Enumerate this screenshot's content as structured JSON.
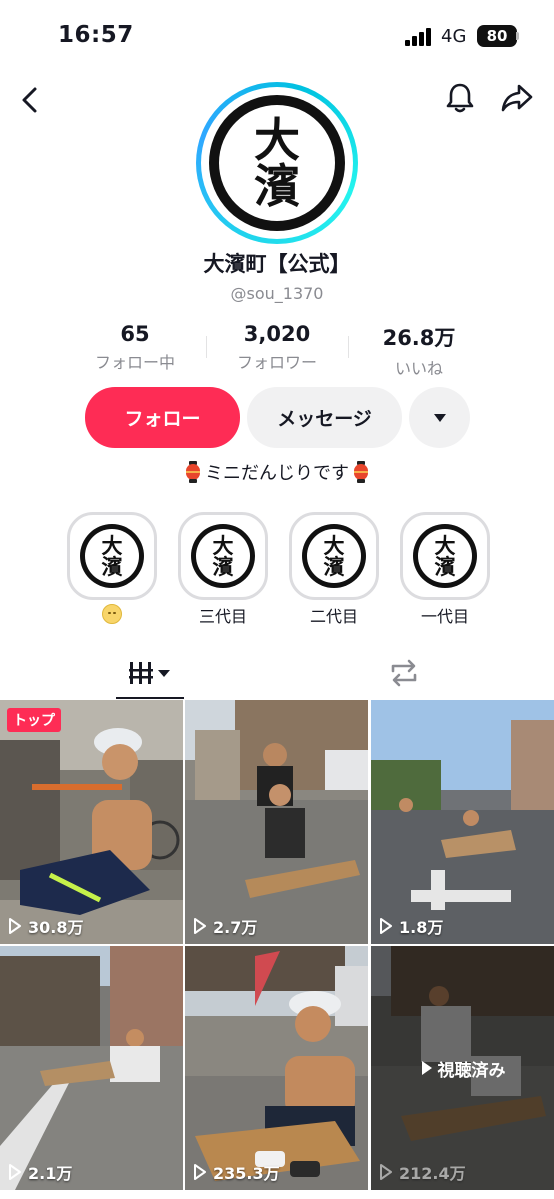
{
  "status": {
    "time": "16:57",
    "network": "4G",
    "battery": "80"
  },
  "header": {
    "back_icon": "chevron-left-icon",
    "bell_icon": "bell-icon",
    "share_icon": "share-arrow-icon"
  },
  "profile": {
    "logo_text_top": "大",
    "logo_text_bottom": "濱",
    "display_name": "大濱町【公式】",
    "username": "@sou_1370"
  },
  "stats": [
    {
      "value": "65",
      "label": "フォロー中"
    },
    {
      "value": "3,020",
      "label": "フォロワー"
    },
    {
      "value": "26.8万",
      "label": "いいね"
    }
  ],
  "actions": {
    "follow": "フォロー",
    "message": "メッセージ"
  },
  "bio": {
    "text": "ミニだんじりです"
  },
  "highlights": [
    {
      "label": ""
    },
    {
      "label": "三代目"
    },
    {
      "label": "二代目"
    },
    {
      "label": "一代目"
    }
  ],
  "tabs": {
    "videos_icon": "grid-icon",
    "repost_icon": "repost-icon"
  },
  "videos": [
    {
      "views": "30.8万",
      "badge": "トップ"
    },
    {
      "views": "2.7万"
    },
    {
      "views": "1.8万"
    },
    {
      "views": "2.1万"
    },
    {
      "views": "235.3万"
    },
    {
      "views": "212.4万",
      "overlay": "視聴済み"
    }
  ],
  "colors": {
    "accent": "#fe2c55",
    "ring": "#20d5ec",
    "muted": "#8a8b91",
    "button_gray": "#f1f1f2"
  }
}
